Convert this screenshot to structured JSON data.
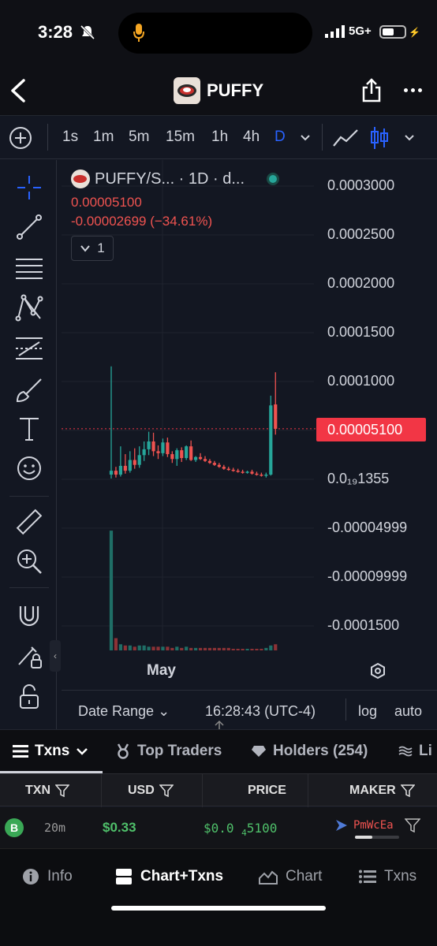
{
  "status_bar": {
    "time": "3:28",
    "network": "5G+"
  },
  "header": {
    "title": "PUFFY"
  },
  "toolbar": {
    "intervals": [
      "1s",
      "1m",
      "5m",
      "15m",
      "1h",
      "4h",
      "D"
    ],
    "active_interval": "D"
  },
  "legend": {
    "symbol": "PUFFY/S... · 1D · d...",
    "price": "0.00005100",
    "change": "-0.00002699 (−34.61%)",
    "indicator_count": "1"
  },
  "chart_data": {
    "type": "candlestick",
    "title": "PUFFY/S... · 1D · d...",
    "last_price": 5.1e-05,
    "y_ticks": [
      "0.0003000",
      "0.0002500",
      "0.0002000",
      "0.0001500",
      "0.0001000",
      "0.00005100",
      "0.0₁₉1355",
      "-0.00004999",
      "-0.00009999",
      "-0.0001500"
    ],
    "x_ticks": [
      "May"
    ],
    "grid": true,
    "candles": [
      {
        "o": 4e-06,
        "h": 0.000115,
        "l": 0.0,
        "c": 8e-06,
        "dir": "up"
      },
      {
        "o": 8e-06,
        "h": 1.2e-05,
        "l": 1e-06,
        "c": 4e-06,
        "dir": "down"
      },
      {
        "o": 4e-06,
        "h": 3.3e-05,
        "l": 2e-06,
        "c": 1.3e-05,
        "dir": "up"
      },
      {
        "o": 1.3e-05,
        "h": 2.5e-05,
        "l": 5e-06,
        "c": 8e-06,
        "dir": "down"
      },
      {
        "o": 8e-06,
        "h": 2.8e-05,
        "l": 6e-06,
        "c": 1.9e-05,
        "dir": "up"
      },
      {
        "o": 1.9e-05,
        "h": 3.1e-05,
        "l": 1e-05,
        "c": 1.4e-05,
        "dir": "down"
      },
      {
        "o": 1.4e-05,
        "h": 3.3e-05,
        "l": 1.1e-05,
        "c": 2.4e-05,
        "dir": "up"
      },
      {
        "o": 2.4e-05,
        "h": 3.8e-05,
        "l": 1.8e-05,
        "c": 3e-05,
        "dir": "up"
      },
      {
        "o": 3e-05,
        "h": 4.8e-05,
        "l": 2.4e-05,
        "c": 3.8e-05,
        "dir": "up"
      },
      {
        "o": 3.8e-05,
        "h": 4.7e-05,
        "l": 2.3e-05,
        "c": 2.8e-05,
        "dir": "down"
      },
      {
        "o": 2.8e-05,
        "h": 3.4e-05,
        "l": 2e-05,
        "c": 2.6e-05,
        "dir": "down"
      },
      {
        "o": 2.6e-05,
        "h": 4.1e-05,
        "l": 2.3e-05,
        "c": 3.7e-05,
        "dir": "up"
      },
      {
        "o": 3.7e-05,
        "h": 4.2e-05,
        "l": 2.2e-05,
        "c": 2.5e-05,
        "dir": "down"
      },
      {
        "o": 2.5e-05,
        "h": 2.8e-05,
        "l": 1.6e-05,
        "c": 2e-05,
        "dir": "down"
      },
      {
        "o": 2e-05,
        "h": 3.1e-05,
        "l": 1.3e-05,
        "c": 2.9e-05,
        "dir": "up"
      },
      {
        "o": 2.9e-05,
        "h": 3.2e-05,
        "l": 1.7e-05,
        "c": 2.1e-05,
        "dir": "down"
      },
      {
        "o": 2.1e-05,
        "h": 3.4e-05,
        "l": 1.9e-05,
        "c": 3.3e-05,
        "dir": "up"
      },
      {
        "o": 3.3e-05,
        "h": 3.9e-05,
        "l": 1.8e-05,
        "c": 1.9e-05,
        "dir": "down"
      },
      {
        "o": 1.9e-05,
        "h": 2.3e-05,
        "l": 1.7e-05,
        "c": 2.2e-05,
        "dir": "up"
      },
      {
        "o": 2.2e-05,
        "h": 2.6e-05,
        "l": 1.9e-05,
        "c": 2e-05,
        "dir": "down"
      },
      {
        "o": 2e-05,
        "h": 2.3e-05,
        "l": 1.7e-05,
        "c": 1.8e-05,
        "dir": "down"
      },
      {
        "o": 1.8e-05,
        "h": 2e-05,
        "l": 1.5e-05,
        "c": 1.6e-05,
        "dir": "down"
      },
      {
        "o": 1.6e-05,
        "h": 1.8e-05,
        "l": 1.3e-05,
        "c": 1.4e-05,
        "dir": "down"
      },
      {
        "o": 1.4e-05,
        "h": 1.6e-05,
        "l": 1.1e-05,
        "c": 1.2e-05,
        "dir": "down"
      },
      {
        "o": 1.2e-05,
        "h": 1.4e-05,
        "l": 9e-06,
        "c": 1e-05,
        "dir": "down"
      },
      {
        "o": 1e-05,
        "h": 1.2e-05,
        "l": 8e-06,
        "c": 9e-06,
        "dir": "down"
      },
      {
        "o": 9e-06,
        "h": 1.1e-05,
        "l": 7e-06,
        "c": 8e-06,
        "dir": "down"
      },
      {
        "o": 8e-06,
        "h": 1e-05,
        "l": 6e-06,
        "c": 7e-06,
        "dir": "down"
      },
      {
        "o": 7e-06,
        "h": 9e-06,
        "l": 5e-06,
        "c": 6e-06,
        "dir": "down"
      },
      {
        "o": 6e-06,
        "h": 8e-06,
        "l": 5e-06,
        "c": 7e-06,
        "dir": "up"
      },
      {
        "o": 7e-06,
        "h": 9e-06,
        "l": 4e-06,
        "c": 5e-06,
        "dir": "down"
      },
      {
        "o": 5e-06,
        "h": 7e-06,
        "l": 3e-06,
        "c": 4e-06,
        "dir": "down"
      },
      {
        "o": 4e-06,
        "h": 6e-06,
        "l": 2e-06,
        "c": 3e-06,
        "dir": "down"
      },
      {
        "o": 3e-06,
        "h": 6e-06,
        "l": 1e-06,
        "c": 4e-06,
        "dir": "up"
      },
      {
        "o": 4e-06,
        "h": 8.5e-05,
        "l": 3e-06,
        "c": 7.5e-05,
        "dir": "up"
      },
      {
        "o": 7.6e-05,
        "h": 0.000109,
        "l": 4.5e-05,
        "c": 5.1e-05,
        "dir": "down"
      }
    ],
    "volumes": [
      0.98,
      0.1,
      0.05,
      0.04,
      0.04,
      0.03,
      0.04,
      0.04,
      0.03,
      0.03,
      0.03,
      0.03,
      0.03,
      0.02,
      0.03,
      0.02,
      0.03,
      0.02,
      0.02,
      0.02,
      0.02,
      0.02,
      0.02,
      0.02,
      0.02,
      0.02,
      0.01,
      0.01,
      0.01,
      0.01,
      0.01,
      0.01,
      0.01,
      0.02,
      0.04,
      0.05
    ]
  },
  "chart_footer": {
    "date_range": "Date Range",
    "clock": "16:28:43 (UTC-4)",
    "log": "log",
    "auto": "auto"
  },
  "tabs": [
    {
      "label": "Txns"
    },
    {
      "label": "Top Traders"
    },
    {
      "label": "Holders (254)"
    },
    {
      "label": "Li"
    }
  ],
  "table": {
    "columns": [
      "TXN",
      "USD",
      "PRICE",
      "MAKER"
    ],
    "rows": [
      {
        "type": "B",
        "age": "20m",
        "usd": "$0.33",
        "price_prefix": "$0.0",
        "price_sub": "4",
        "price_rest": "5100",
        "maker": "PmWcEa"
      }
    ]
  },
  "bottom_nav": [
    {
      "label": "Info"
    },
    {
      "label": "Chart+Txns"
    },
    {
      "label": "Chart"
    },
    {
      "label": "Txns"
    }
  ],
  "colors": {
    "up": "#26a69a",
    "down": "#ef5350",
    "accent": "#2962ff",
    "price_tag": "#f23645"
  }
}
